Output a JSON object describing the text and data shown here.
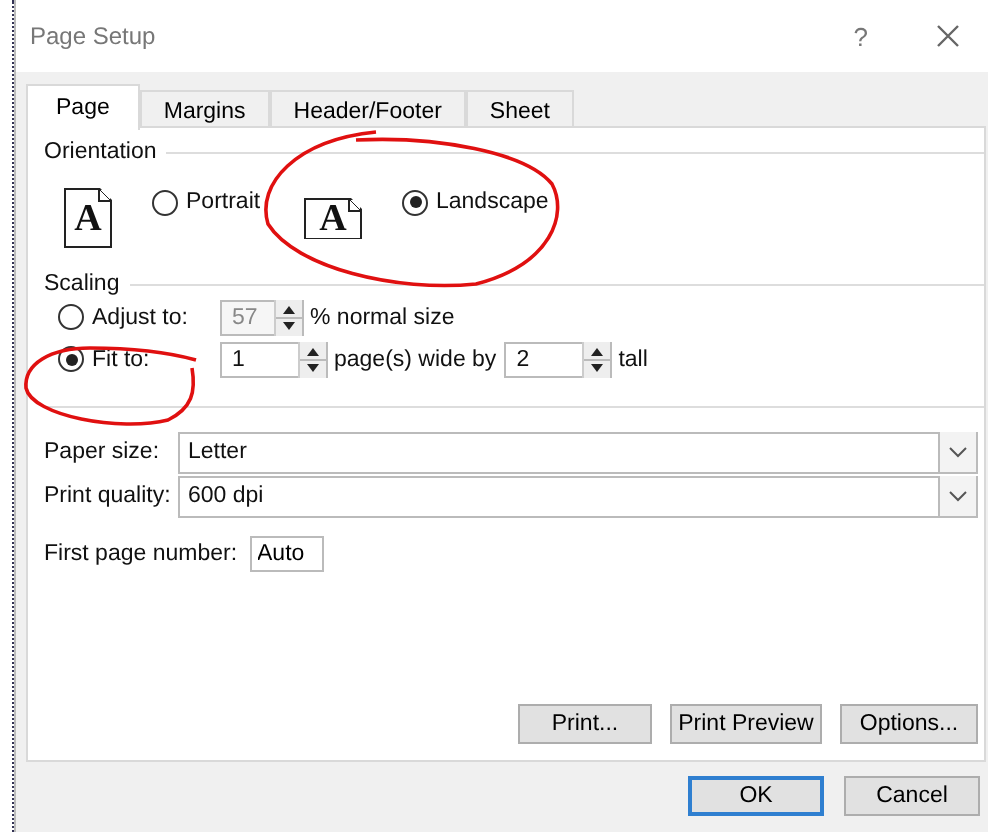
{
  "window": {
    "title": "Page Setup",
    "help": "?"
  },
  "tabs": [
    {
      "label": "Page",
      "selected": true
    },
    {
      "label": "Margins",
      "selected": false
    },
    {
      "label": "Header/Footer",
      "selected": false
    },
    {
      "label": "Sheet",
      "selected": false
    }
  ],
  "orientation": {
    "label": "Orientation",
    "options": [
      {
        "kind": "portrait",
        "icon_letter": "A",
        "label": "Portrait",
        "selected": false
      },
      {
        "kind": "landscape",
        "icon_letter": "A",
        "label": "Landscape",
        "selected": true
      }
    ]
  },
  "scaling": {
    "label": "Scaling",
    "options": [
      {
        "kind": "adjust",
        "label": "Adjust to:",
        "selected": false,
        "value": "57",
        "suffix": "% normal size"
      },
      {
        "kind": "fit",
        "label": "Fit to:",
        "selected": true,
        "value": "1",
        "suffix": "page(s) wide by",
        "value_2": "2",
        "suffix_2": "tall"
      }
    ]
  },
  "paper_size": {
    "label": "Paper size:",
    "value": "Letter"
  },
  "print_quality": {
    "label": "Print quality:",
    "value": "600 dpi"
  },
  "first_page_number": {
    "label": "First page number:",
    "value": "Auto"
  },
  "panel_buttons": [
    "Print...",
    "Print Preview",
    "Options..."
  ],
  "dialog_buttons": [
    {
      "label": "OK",
      "default": true
    },
    {
      "label": "Cancel",
      "default": false
    }
  ]
}
